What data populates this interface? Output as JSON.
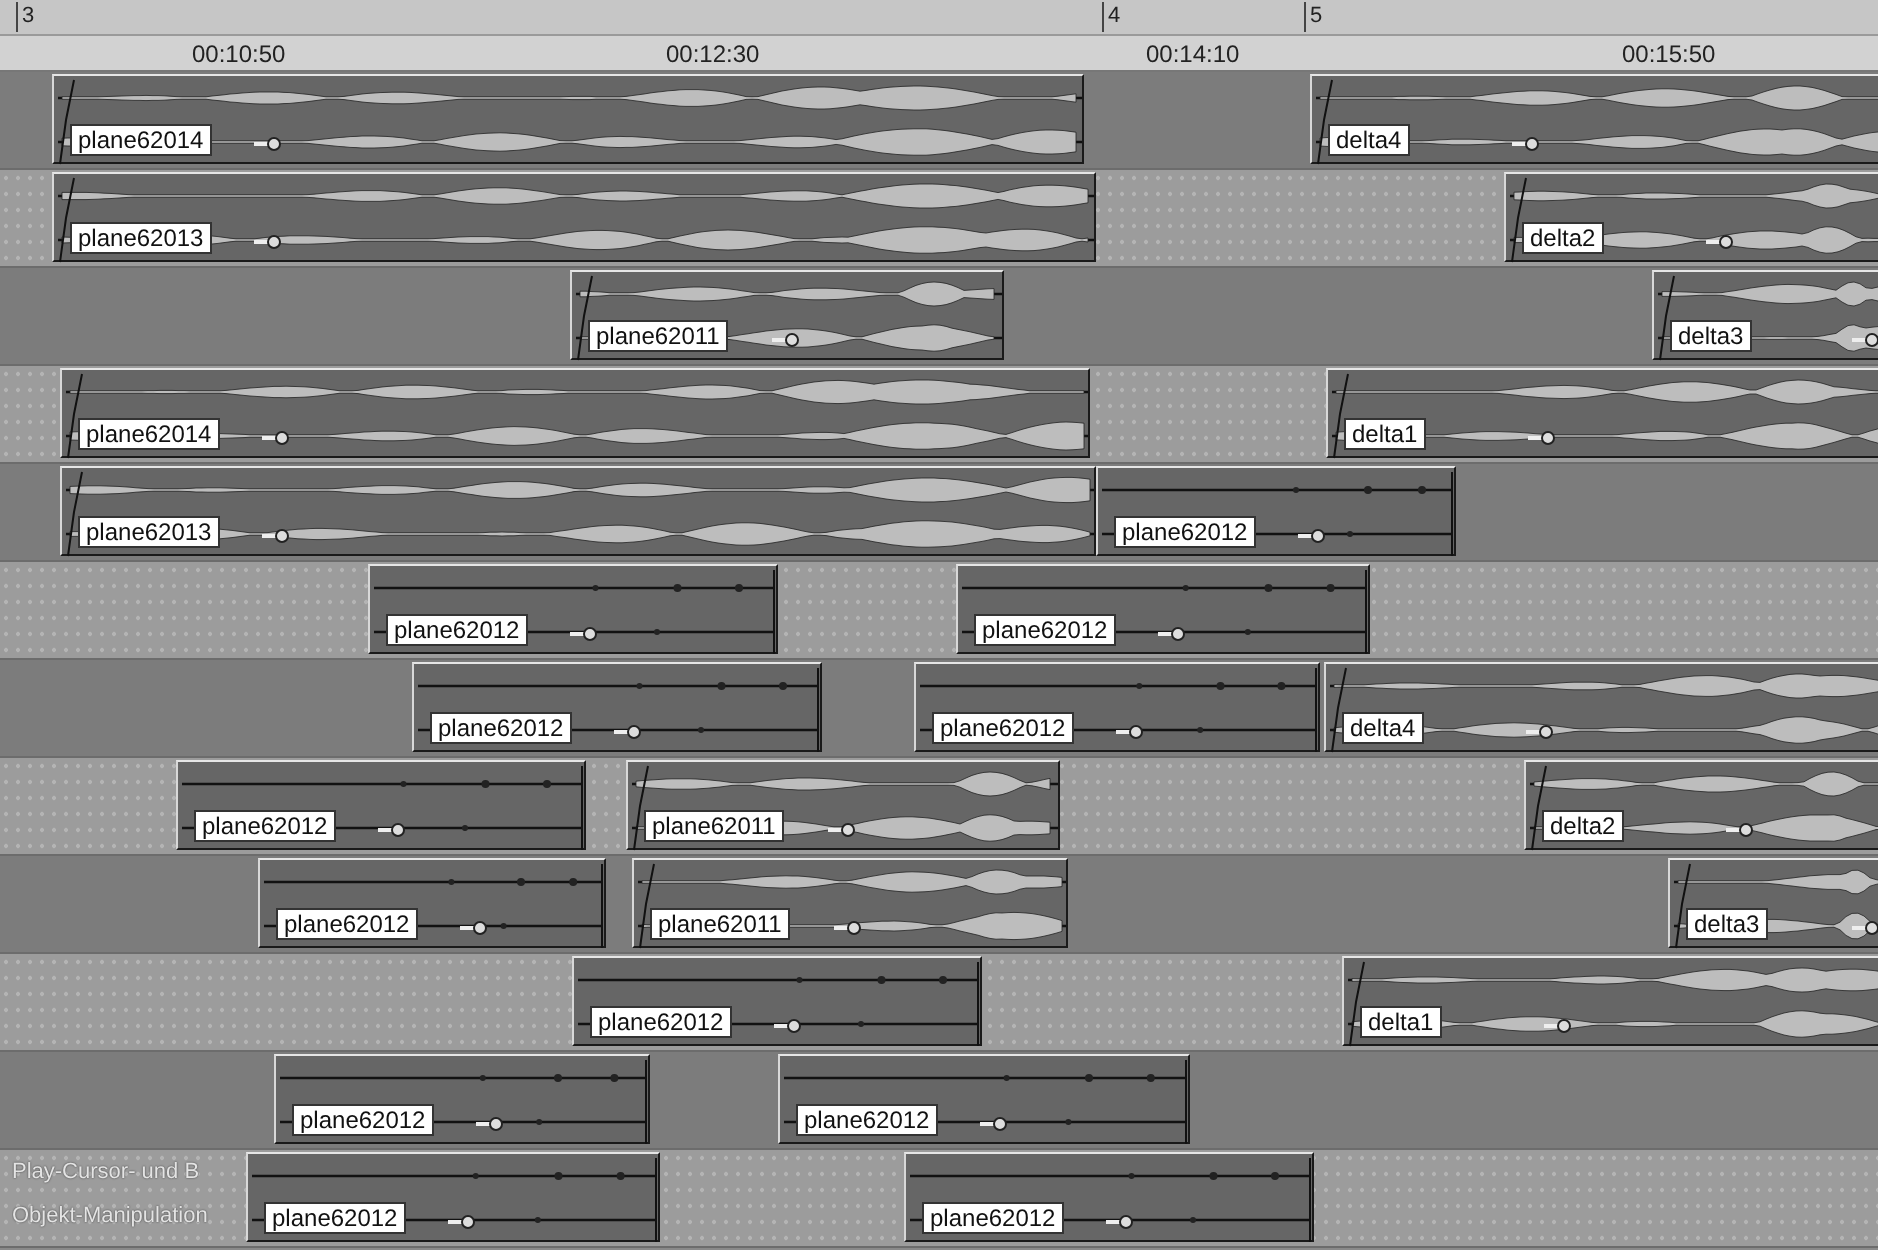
{
  "ruler": {
    "markers": [
      "3",
      "4",
      "5"
    ],
    "times": [
      "00:10:50",
      "00:12:30",
      "00:14:10",
      "00:15:50"
    ]
  },
  "tracks": [
    {
      "clips": [
        {
          "name": "plane62014",
          "kind": "waveform"
        },
        {
          "name": "delta4",
          "kind": "waveform"
        }
      ]
    },
    {
      "clips": [
        {
          "name": "plane62013",
          "kind": "waveform"
        },
        {
          "name": "delta2",
          "kind": "waveform"
        }
      ]
    },
    {
      "clips": [
        {
          "name": "plane62011",
          "kind": "waveform"
        },
        {
          "name": "delta3",
          "kind": "waveform"
        }
      ]
    },
    {
      "clips": [
        {
          "name": "plane62014",
          "kind": "waveform"
        },
        {
          "name": "delta1",
          "kind": "waveform"
        }
      ]
    },
    {
      "clips": [
        {
          "name": "plane62013",
          "kind": "waveform"
        },
        {
          "name": "plane62012",
          "kind": "sparse"
        }
      ]
    },
    {
      "clips": [
        {
          "name": "plane62012",
          "kind": "sparse"
        },
        {
          "name": "plane62012",
          "kind": "sparse"
        }
      ]
    },
    {
      "clips": [
        {
          "name": "plane62012",
          "kind": "sparse"
        },
        {
          "name": "plane62012",
          "kind": "sparse"
        },
        {
          "name": "delta4",
          "kind": "waveform"
        }
      ]
    },
    {
      "clips": [
        {
          "name": "plane62012",
          "kind": "sparse"
        },
        {
          "name": "plane62011",
          "kind": "waveform"
        },
        {
          "name": "delta2",
          "kind": "waveform"
        }
      ]
    },
    {
      "clips": [
        {
          "name": "plane62012",
          "kind": "sparse"
        },
        {
          "name": "plane62011",
          "kind": "waveform"
        },
        {
          "name": "delta3",
          "kind": "waveform"
        }
      ]
    },
    {
      "clips": [
        {
          "name": "plane62012",
          "kind": "sparse"
        },
        {
          "name": "delta1",
          "kind": "waveform"
        }
      ]
    },
    {
      "clips": [
        {
          "name": "plane62012",
          "kind": "sparse"
        },
        {
          "name": "plane62012",
          "kind": "sparse"
        }
      ]
    },
    {
      "clips": [
        {
          "name": "plane62012",
          "kind": "sparse"
        },
        {
          "name": "plane62012",
          "kind": "sparse"
        }
      ]
    }
  ],
  "overlay_lines": [
    "Play-Cursor- und B",
    "Objekt-Manipulation"
  ]
}
